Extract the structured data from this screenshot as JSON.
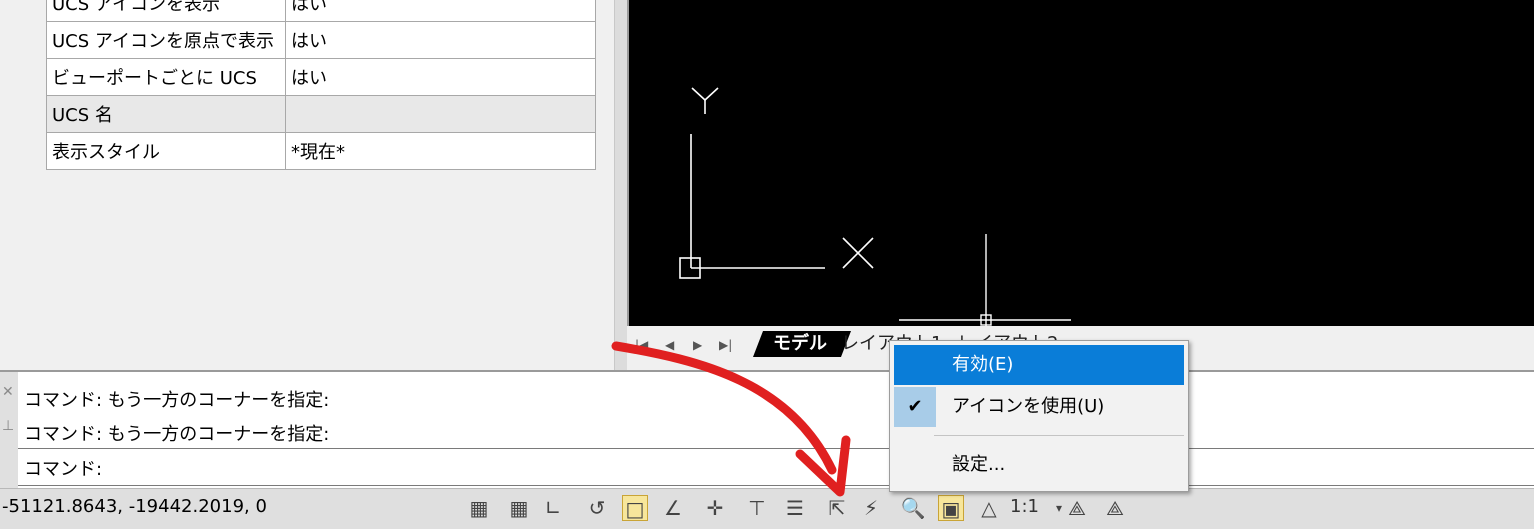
{
  "properties": {
    "rows": [
      {
        "key": "UCS アイコンを表示",
        "value": "はい"
      },
      {
        "key": "UCS アイコンを原点で表示",
        "value": "はい"
      },
      {
        "key": "ビューポートごとに UCS",
        "value": "はい"
      },
      {
        "key": "UCS 名",
        "value": ""
      },
      {
        "key": "表示スタイル",
        "value": "*現在*"
      }
    ]
  },
  "viewport": {
    "ucs_y_label": "Y",
    "ucs_x_label": "X"
  },
  "layout_tabs": {
    "model": "モデル",
    "layout1": "レイアウト1",
    "layout2": "レイアウト2"
  },
  "command": {
    "history": [
      "コマンド:  もう一方のコーナーを指定:",
      "コマンド:  もう一方のコーナーを指定:"
    ],
    "prompt": "コマンド:"
  },
  "status_bar": {
    "coordinates": "-51121.8643, -19442.2019, 0",
    "scale": "1:1"
  },
  "context_menu": {
    "items": [
      {
        "label": "有効(E)",
        "highlighted": true
      },
      {
        "label": "アイコンを使用(U)",
        "checked": true
      },
      {
        "label": "設定..."
      }
    ]
  },
  "colors": {
    "highlight": "#0a7dd8",
    "annotation_arrow": "#e02020",
    "viewport_bg": "#000000"
  }
}
